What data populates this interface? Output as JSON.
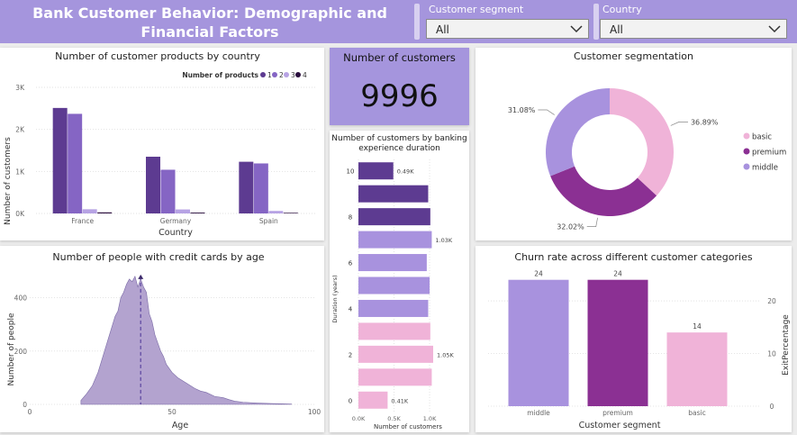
{
  "header": {
    "title": "Bank Customer Behavior: Demographic and Financial Factors",
    "filters": [
      {
        "label": "Customer segment",
        "value": "All"
      },
      {
        "label": "Country",
        "value": "All"
      }
    ]
  },
  "kpi": {
    "label": "Number of customers",
    "value": "9996"
  },
  "colors": {
    "header": "#a595dd",
    "p1": "#5d3b91",
    "p2": "#8565c4",
    "p3": "#b7a3e4",
    "p4": "#2a0e3d",
    "pink": "#f0b3d8",
    "magenta": "#8b3093",
    "lavender": "#a892de",
    "area": "#b3a3cf"
  },
  "chart_data": [
    {
      "type": "bar",
      "title": "Number of customer products by country",
      "xlabel": "Country",
      "ylabel": "Number of customers",
      "legend_title": "Number of products",
      "legend_position": "top-right",
      "categories": [
        "France",
        "Germany",
        "Spain"
      ],
      "series": [
        {
          "name": "1",
          "values": [
            2510,
            1350,
            1230
          ]
        },
        {
          "name": "2",
          "values": [
            2370,
            1040,
            1190
          ]
        },
        {
          "name": "3",
          "values": [
            100,
            95,
            60
          ]
        },
        {
          "name": "4",
          "values": [
            25,
            20,
            15
          ]
        }
      ],
      "yticks": [
        "0K",
        "1K",
        "2K",
        "3K"
      ],
      "ylim": [
        0,
        3000
      ]
    },
    {
      "type": "pie",
      "title": "Customer segmentation",
      "labels": [
        "basic",
        "premium",
        "middle"
      ],
      "values": [
        36.89,
        32.02,
        31.08
      ],
      "value_labels": [
        "36.89%",
        "32.02%",
        "31.08%"
      ],
      "legend_position": "right"
    },
    {
      "type": "bar",
      "orientation": "horizontal",
      "title": "Number of customers by banking experience duration",
      "xlabel": "Number of customers",
      "ylabel": "Duration (years)",
      "categories": [
        "10",
        "9",
        "8",
        "7",
        "6",
        "5",
        "4",
        "3",
        "2",
        "1",
        "0"
      ],
      "values": [
        490,
        980,
        1010,
        1030,
        960,
        1000,
        980,
        1010,
        1050,
        1030,
        410
      ],
      "data_labels": [
        "0.49K",
        "",
        "",
        "1.03K",
        "",
        "",
        "",
        "",
        "1.05K",
        "",
        "0.41K"
      ],
      "ytick_labels": [
        "10",
        "",
        "8",
        "",
        "6",
        "",
        "4",
        "",
        "2",
        "",
        "0"
      ],
      "xticks": [
        "0.0K",
        "0.5K",
        "1.0K"
      ],
      "xlim": [
        0,
        1050
      ]
    },
    {
      "type": "area",
      "title": "Number of people with credit cards by age",
      "xlabel": "Age",
      "ylabel": "Number of people",
      "x": [
        18,
        20,
        22,
        24,
        26,
        28,
        30,
        31,
        32,
        33,
        34,
        35,
        36,
        37,
        38,
        39,
        40,
        41,
        42,
        43,
        44,
        45,
        46,
        47,
        48,
        50,
        52,
        55,
        58,
        60,
        62,
        65,
        68,
        70,
        72,
        75,
        80,
        85,
        92
      ],
      "y": [
        15,
        40,
        70,
        120,
        190,
        260,
        330,
        350,
        400,
        420,
        450,
        470,
        460,
        480,
        440,
        470,
        440,
        420,
        340,
        310,
        260,
        230,
        200,
        180,
        150,
        120,
        100,
        80,
        60,
        50,
        45,
        30,
        25,
        18,
        12,
        8,
        5,
        3,
        1
      ],
      "xticks": [
        "0",
        "50",
        "100"
      ],
      "yticks": [
        "0",
        "200",
        "400"
      ],
      "xlim": [
        0,
        100
      ],
      "ylim": [
        0,
        520
      ],
      "reference_line_age": 39
    },
    {
      "type": "bar",
      "title": "Churn rate across different customer categories",
      "xlabel": "Customer segment",
      "ylabel": "ExitPercentage",
      "categories": [
        "middle",
        "premium",
        "basic"
      ],
      "values": [
        24,
        24,
        14
      ],
      "data_labels": [
        "24",
        "24",
        "14"
      ],
      "yticks": [
        "0",
        "10",
        "20"
      ],
      "ylim": [
        0,
        26
      ]
    }
  ]
}
